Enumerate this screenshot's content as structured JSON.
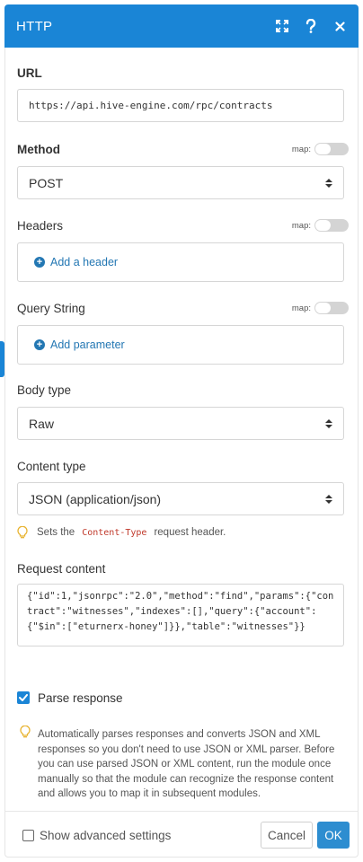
{
  "window": {
    "title": "HTTP"
  },
  "url": {
    "label": "URL",
    "value": "https://api.hive-engine.com/rpc/contracts"
  },
  "method": {
    "label": "Method",
    "map_label": "map:",
    "value": "POST"
  },
  "headers": {
    "label": "Headers",
    "map_label": "map:",
    "add_label": "Add a header"
  },
  "query_string": {
    "label": "Query String",
    "map_label": "map:",
    "add_label": "Add parameter"
  },
  "body_type": {
    "label": "Body type",
    "value": "Raw"
  },
  "content_type": {
    "label": "Content type",
    "value": "JSON (application/json)",
    "hint_before": "Sets the",
    "hint_code": "Content-Type",
    "hint_after": "request header."
  },
  "request_content": {
    "label": "Request content",
    "value": "{\"id\":1,\"jsonrpc\":\"2.0\",\"method\":\"find\",\"params\":{\"contract\":\"witnesses\",\"indexes\":[],\"query\":{\"account\":{\"$in\":[\"eturnerx-honey\"]}},\"table\":\"witnesses\"}}"
  },
  "parse_response": {
    "label": "Parse response",
    "checked": true,
    "note": "Automatically parses responses and converts JSON and XML responses so you don't need to use JSON or XML parser. Before you can use parsed JSON or XML content, run the module once manually so that the module can recognize the response content and allows you to map it in subsequent modules."
  },
  "footer": {
    "advanced_label": "Show advanced settings",
    "cancel_label": "Cancel",
    "ok_label": "OK"
  },
  "colors": {
    "accent": "#1a85d6",
    "link": "#2377b3",
    "code": "#c0392b"
  },
  "icons": [
    "expand-icon",
    "help-icon",
    "close-icon",
    "plus-circle-icon",
    "lightbulb-icon",
    "check-icon"
  ]
}
